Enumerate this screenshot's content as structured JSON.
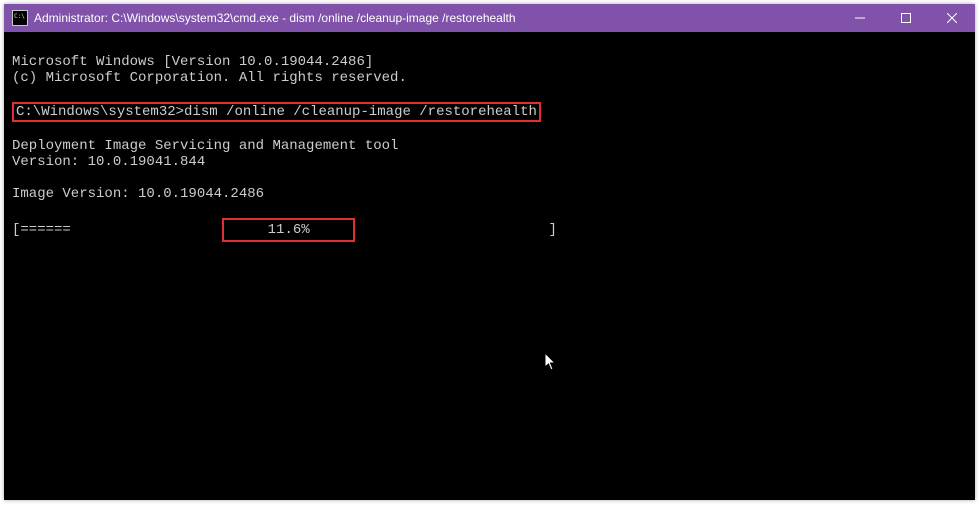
{
  "window": {
    "title": "Administrator: C:\\Windows\\system32\\cmd.exe - dism  /online /cleanup-image /restorehealth"
  },
  "terminal": {
    "header1": "Microsoft Windows [Version 10.0.19044.2486]",
    "header2": "(c) Microsoft Corporation. All rights reserved.",
    "prompt": "C:\\Windows\\system32>",
    "command": "dism /online /cleanup-image /restorehealth",
    "tool_line1": "Deployment Image Servicing and Management tool",
    "tool_line2": "Version: 10.0.19041.844",
    "image_version": "Image Version: 10.0.19044.2486",
    "progress_left": "[======",
    "progress_percent": "11.6%",
    "progress_box_pad_left": "    ",
    "progress_box_pad_right": "    ",
    "progress_right": "                       ] "
  }
}
